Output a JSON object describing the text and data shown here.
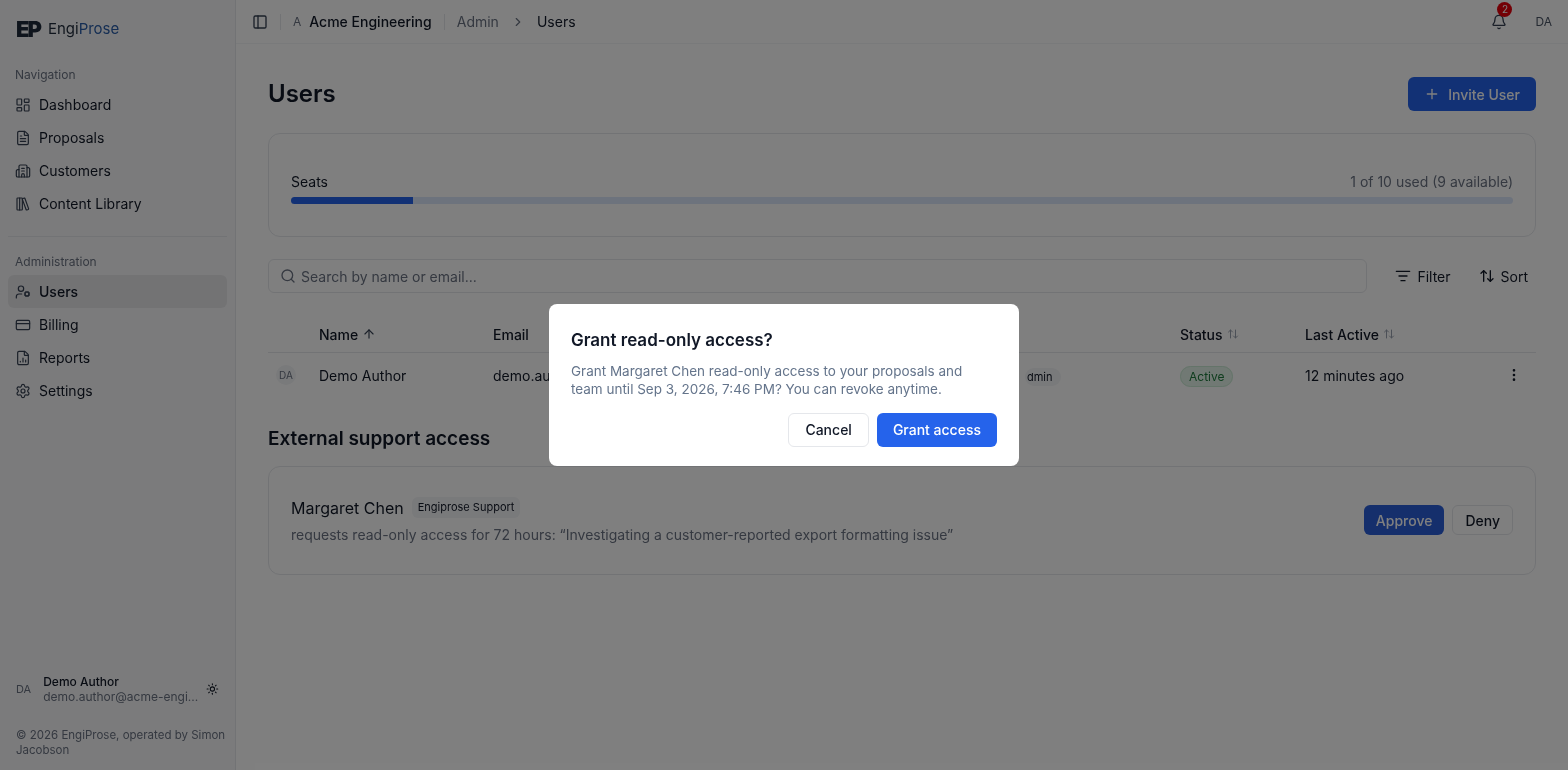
{
  "brand": {
    "mark": "EP",
    "name_start": "Engi",
    "name_end": "Prose"
  },
  "sidebar": {
    "sections": [
      {
        "title": "Navigation",
        "items": [
          {
            "label": "Dashboard",
            "selected": false
          },
          {
            "label": "Proposals",
            "selected": false
          },
          {
            "label": "Customers",
            "selected": false
          },
          {
            "label": "Content Library",
            "selected": false
          }
        ]
      },
      {
        "title": "Administration",
        "items": [
          {
            "label": "Users",
            "selected": true
          },
          {
            "label": "Billing",
            "selected": false
          },
          {
            "label": "Reports",
            "selected": false
          },
          {
            "label": "Settings",
            "selected": false
          }
        ]
      }
    ],
    "user": {
      "initials": "DA",
      "name": "Demo Author",
      "email": "demo.author@acme-engi..."
    },
    "footer": "© 2026 EngiProse, operated by Simon Jacobson"
  },
  "header": {
    "org_initial": "A",
    "org": "Acme Engineering",
    "breadcrumbs": [
      "Admin",
      "Users"
    ],
    "notifications": "2",
    "initials": "DA"
  },
  "page": {
    "title": "Users",
    "invite_button": "Invite User",
    "seats": {
      "label": "Seats",
      "reading": "1 of 10 used (9 available)",
      "level": 0.1
    },
    "search": {
      "placeholder": "Search by name or email..."
    },
    "filter_button": "Filter",
    "sort_button": "Sort",
    "table": {
      "columns": [
        {
          "label": "Name",
          "kind": "sorted"
        },
        {
          "label": "Email",
          "kind": "plain"
        },
        {
          "label": "Status",
          "kind": "sortable"
        },
        {
          "label": "Last Active",
          "kind": "sortable"
        }
      ],
      "rows": [
        {
          "initials": "DA",
          "name": "Demo Author",
          "email": "demo.au",
          "role": "dmin",
          "status": "Active",
          "last_active": "12 minutes ago"
        }
      ]
    },
    "external": {
      "title": "External support access",
      "requests": [
        {
          "name": "Margaret Chen",
          "badge": "Engiprose Support",
          "text": "requests read-only access for 72 hours: “Investigating a customer-reported export formatting issue”",
          "approve": "Approve",
          "deny": "Deny"
        }
      ]
    }
  },
  "dialog": {
    "title": "Grant read-only access?",
    "text": "Grant Margaret Chen read-only access to your proposals and team until Sep 3, 2026, 7:46 PM? You can revoke anytime.",
    "cancel": "Cancel",
    "confirm": "Grant access"
  }
}
